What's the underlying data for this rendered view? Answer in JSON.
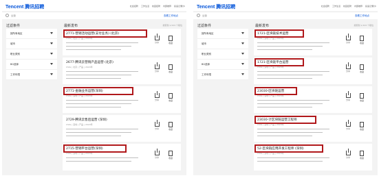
{
  "left": {
    "logo": "Tencent 腾讯招聘",
    "nav": [
      "社会招聘",
      "工作生活",
      "校园招聘",
      "内部推荐",
      "投递记录"
    ],
    "lang": "简体",
    "search": {
      "placeholder": "运营",
      "button": "查看工作地点"
    },
    "filter_title": "过滤条件",
    "filters": [
      "按所有地区",
      "城市",
      "职业类别",
      "BG选择",
      "工作年限"
    ],
    "results_title": "最新发布",
    "results_count": "搜索到 1,523 个职位",
    "share_label": "分享",
    "save_label": "收藏",
    "jobs": [
      {
        "title": "2771-营销活动运营(支付业务) (北京)",
        "meta": "CSIG | 北京 | 产品 | 2020年"
      },
      {
        "title": "2677-腾讯云营销产品运营 (北京)",
        "meta": "CSIG | 北京 | 产品 | 2020年"
      },
      {
        "title": "2771-金融业务运营(深圳)",
        "meta": "CSIG | 深圳 | 产品 | 2020年"
      },
      {
        "title": "2729-腾讯云售后运营 (深圳)",
        "meta": "CSIG | 深圳 | 产品 | 2020年"
      },
      {
        "title": "2715-营销平台运营(深圳)",
        "meta": "CSIG | 深圳 | 产品 | 2020年"
      }
    ]
  },
  "right": {
    "logo": "Tencent 腾讯招聘",
    "nav": [
      "社会招聘",
      "工作生活",
      "校园招聘",
      "内部推荐",
      "投递记录"
    ],
    "lang": "简体",
    "search": {
      "placeholder": "运营",
      "button": "查看工作地点"
    },
    "filter_title": "过滤条件",
    "filters": [
      "按所有地区",
      "城市",
      "职业类别",
      "BG选择",
      "工作年限"
    ],
    "results_title": "最新发布",
    "results_count": "搜索到 1,523 个职位",
    "share_label": "分享",
    "save_label": "收藏",
    "jobs": [
      {
        "title": "1721-区块链技术运营",
        "meta": "CSIG | 深圳 | 产品 | 2020年"
      },
      {
        "title": "1721-区块链平台运营",
        "meta": "CSIG | 深圳 | 产品 | 2020年"
      },
      {
        "title": "23030-区块链运营",
        "meta": "CSIG | 深圳 | 产品 | 2020年"
      },
      {
        "title": "23030-计区块链运营工程师",
        "meta": "CSIG | 深圳 | 产品 | 2020年"
      },
      {
        "title": "52-区块链应用开发工程师 (深圳)",
        "meta": "CSIG | 深圳 | 产品 | 2020年"
      }
    ]
  },
  "colors": {
    "brand": "#0052d9",
    "highlight": "#b0171a",
    "background": "#f3f3f3"
  }
}
